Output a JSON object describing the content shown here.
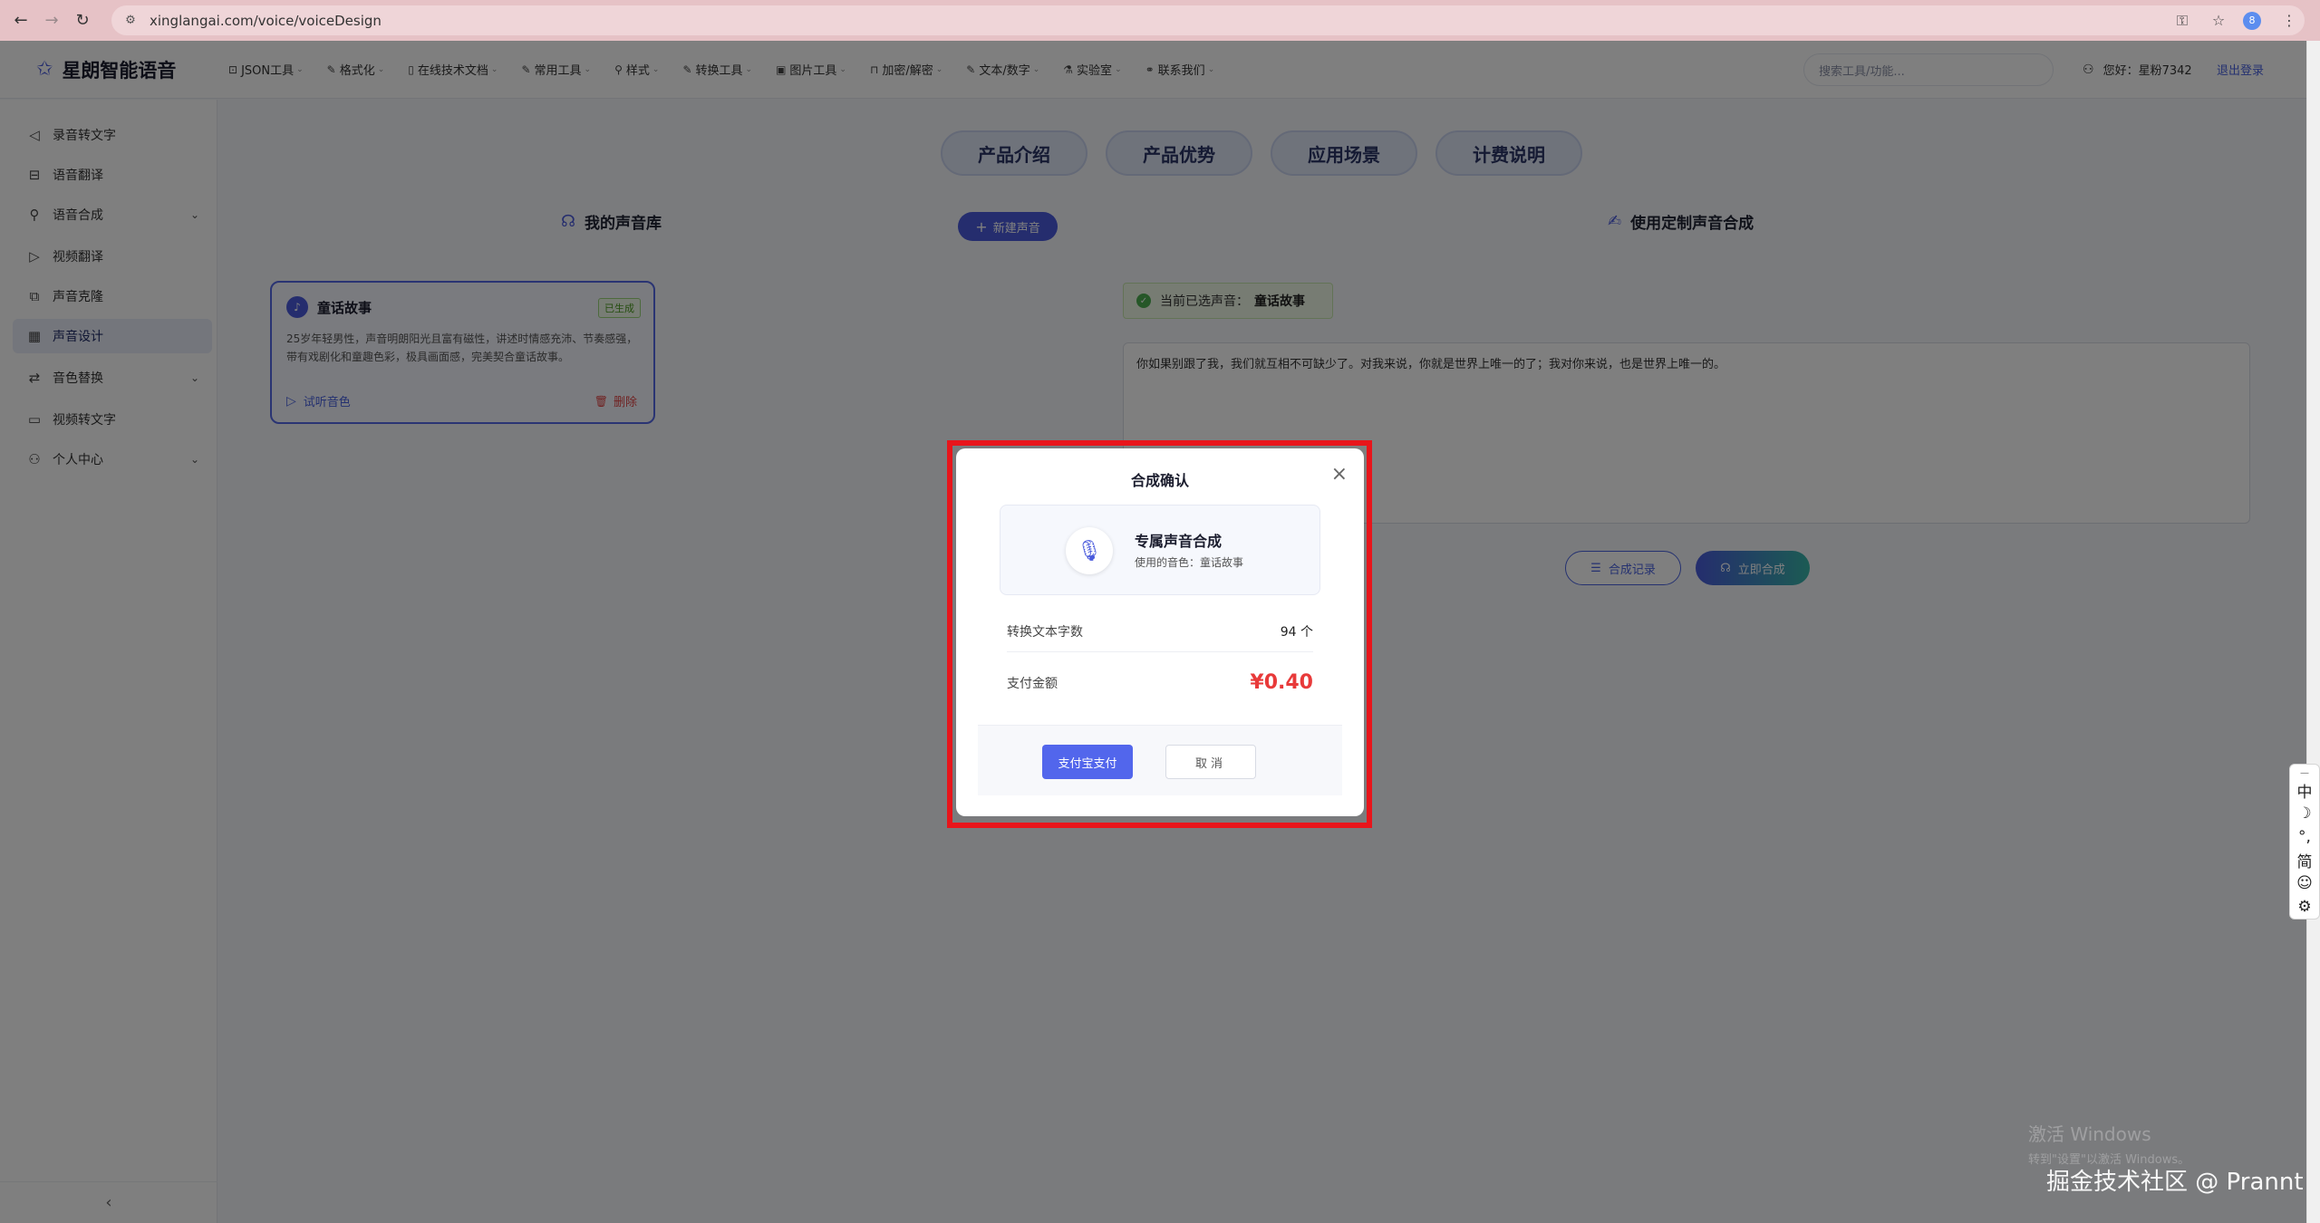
{
  "browser": {
    "url": "xinglangai.com/voice/voiceDesign",
    "back_icon": "←",
    "forward_icon": "→",
    "reload_icon": "↻",
    "site_icon": "⚙",
    "key_icon": "⚿",
    "star_icon": "☆",
    "profile_initial": "8",
    "menu_icon": "⋮"
  },
  "header": {
    "logo_icon": "✩",
    "brand": "星朗智能语音",
    "menu": [
      {
        "icon": "⊡",
        "label": "JSON工具"
      },
      {
        "icon": "✎",
        "label": "格式化"
      },
      {
        "icon": "▯",
        "label": "在线技术文档"
      },
      {
        "icon": "✎",
        "label": "常用工具"
      },
      {
        "icon": "⚲",
        "label": "样式"
      },
      {
        "icon": "✎",
        "label": "转换工具"
      },
      {
        "icon": "▣",
        "label": "图片工具"
      },
      {
        "icon": "⊓",
        "label": "加密/解密"
      },
      {
        "icon": "✎",
        "label": "文本/数字"
      },
      {
        "icon": "⚗",
        "label": "实验室"
      },
      {
        "icon": "⚭",
        "label": "联系我们"
      }
    ],
    "caret": "⌄",
    "search_placeholder": "搜索工具/功能...",
    "user_icon": "⚇",
    "greeting": "您好：星粉7342",
    "logout": "退出登录"
  },
  "sidebar": {
    "items": [
      {
        "icon": "◁",
        "label": "录音转文字"
      },
      {
        "icon": "⊟",
        "label": "语音翻译"
      },
      {
        "icon": "⚲",
        "label": "语音合成",
        "expandable": true
      },
      {
        "icon": "▷",
        "label": "视频翻译"
      },
      {
        "icon": "⧉",
        "label": "声音克隆"
      },
      {
        "icon": "▦",
        "label": "声音设计",
        "active": true
      },
      {
        "icon": "⇄",
        "label": "音色替换",
        "expandable": true
      },
      {
        "icon": "▭",
        "label": "视频转文字"
      },
      {
        "icon": "⚇",
        "label": "个人中心",
        "expandable": true
      }
    ],
    "chevron": "⌄",
    "collapse_icon": "‹"
  },
  "main": {
    "tabs": [
      "产品介绍",
      "产品优势",
      "应用场景",
      "计费说明"
    ],
    "library_icon": "☊",
    "library_title": "我的声音库",
    "new_voice_plus": "+",
    "new_voice": "新建声音",
    "custom_icon": "✍",
    "custom_title": "使用定制声音合成",
    "voice_card": {
      "mic_icon": "♪",
      "name": "童话故事",
      "badge": "已生成",
      "description": "25岁年轻男性，声音明朗阳光且富有磁性，讲述时情感充沛、节奏感强，带有戏剧化和童趣色彩，极具画面感，完美契合童话故事。",
      "listen_icon": "▷",
      "listen": "试听音色",
      "delete_icon": "🗑",
      "delete": "删除"
    },
    "current_check": "✓",
    "current_label": "当前已选声音：",
    "current_voice": "童话故事",
    "text": "你如果别跟了我，我们就互相不可缺少了。对我来说，你就是世界上唯一的了；我对你来说，也是世界上唯一的。",
    "history_icon": "☰",
    "history": "合成记录",
    "synth_icon": "☊",
    "synth": "立即合成"
  },
  "modal": {
    "title": "合成确认",
    "close_icon": "×",
    "mic_icon": "🎙",
    "service": "专属声音合成",
    "voice_used": "使用的音色：童话故事",
    "char_label": "转换文本字数",
    "char_value": "94 个",
    "amount_label": "支付金额",
    "amount_value": "¥0.40",
    "pay": "支付宝支付",
    "cancel": "取消"
  },
  "ime": {
    "handle": "—",
    "items": [
      "中",
      "☽",
      "°,",
      "简",
      "☺",
      "⚙"
    ]
  },
  "overlay_text": {
    "win1": "激活 Windows",
    "win2": "转到\"设置\"以激活 Windows。",
    "juejin": "掘金技术社区 @ Prannt"
  },
  "colors": {
    "accent": "#4a5bdc",
    "highlight": "#e8151b",
    "price": "#e83a3a",
    "success": "#4caf50"
  }
}
